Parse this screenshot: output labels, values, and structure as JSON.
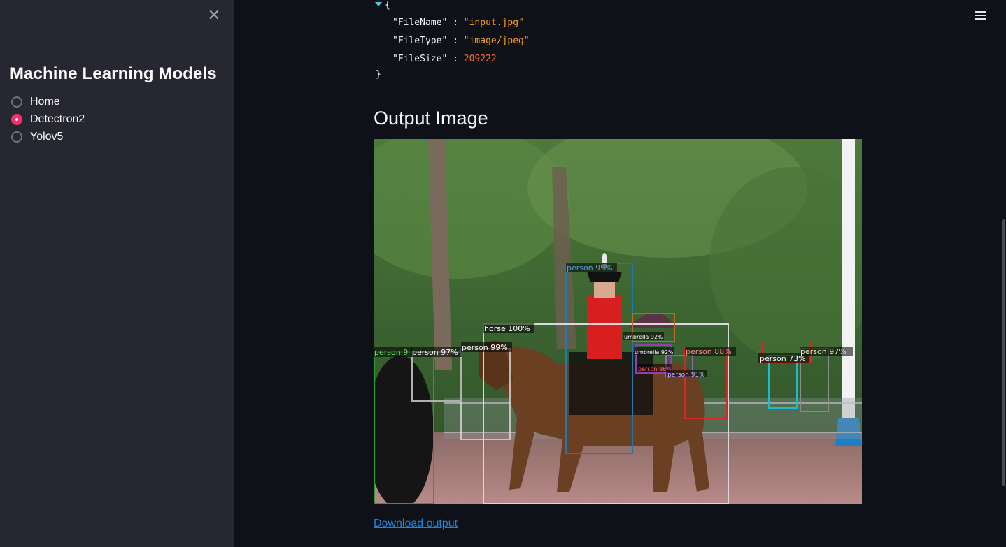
{
  "sidebar": {
    "title": "Machine Learning Models",
    "options": [
      {
        "label": "Home",
        "selected": false
      },
      {
        "label": "Detectron2",
        "selected": true
      },
      {
        "label": "Yolov5",
        "selected": false
      }
    ]
  },
  "json_view": {
    "open_brace": "{",
    "close_brace": "}",
    "entries": [
      {
        "key": "\"FileName\"",
        "value": "\"input.jpg\"",
        "kind": "string"
      },
      {
        "key": "\"FileType\"",
        "value": "\"image/jpeg\"",
        "kind": "string"
      },
      {
        "key": "\"FileSize\"",
        "value": "209222",
        "kind": "number"
      }
    ]
  },
  "output": {
    "title": "Output Image",
    "detections": [
      {
        "label": "person 99%",
        "color": "#1f77b4"
      },
      {
        "label": "horse 100%",
        "color": "#d9d9d9"
      },
      {
        "label": "person 99%",
        "color": "#d9d9d9"
      },
      {
        "label": "person 9",
        "color": "#2ca02c"
      },
      {
        "label": "person 97%",
        "color": "#b0b0b0"
      },
      {
        "label": "umbrella 92%",
        "color": "#bb6a2a"
      },
      {
        "label": "umbrella 92%",
        "color": "#8f3fb0"
      },
      {
        "label": "person 96%",
        "color": "#d62728"
      },
      {
        "label": "person 88%",
        "color": "#d62728"
      },
      {
        "label": "person 91%",
        "color": "#9467bd"
      },
      {
        "label": "person 73%",
        "color": "#17becf"
      },
      {
        "label": "person 97%",
        "color": "#8c8c8c"
      }
    ],
    "download_label": "Download output"
  },
  "icons": {
    "close": "close-icon",
    "menu": "hamburger-menu-icon",
    "expand": "caret-down-icon"
  }
}
